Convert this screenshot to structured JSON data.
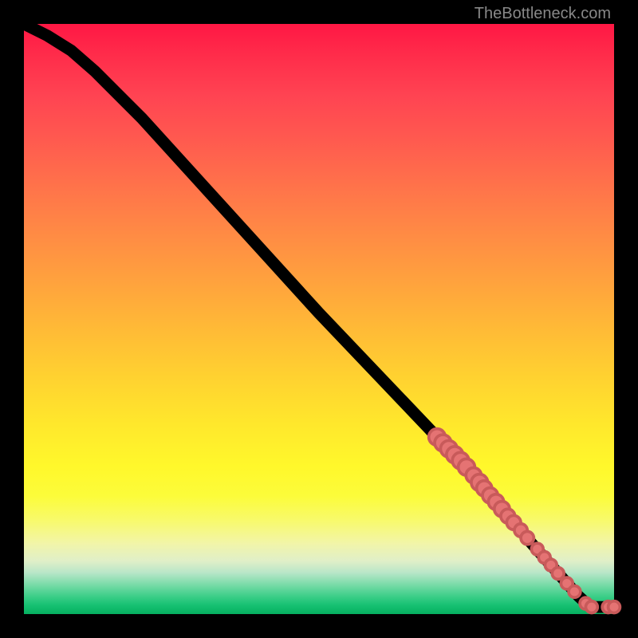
{
  "attribution": "TheBottleneck.com",
  "chart_data": {
    "type": "line",
    "title": "",
    "xlabel": "",
    "ylabel": "",
    "xlim": [
      0,
      100
    ],
    "ylim": [
      0,
      100
    ],
    "curve": [
      {
        "x": 0,
        "y": 100
      },
      {
        "x": 4,
        "y": 98
      },
      {
        "x": 8,
        "y": 95.5
      },
      {
        "x": 12,
        "y": 92
      },
      {
        "x": 20,
        "y": 84
      },
      {
        "x": 30,
        "y": 73
      },
      {
        "x": 40,
        "y": 62
      },
      {
        "x": 50,
        "y": 51
      },
      {
        "x": 60,
        "y": 40.5
      },
      {
        "x": 70,
        "y": 30
      },
      {
        "x": 80,
        "y": 19
      },
      {
        "x": 86,
        "y": 12
      },
      {
        "x": 90,
        "y": 7.5
      },
      {
        "x": 94,
        "y": 3
      },
      {
        "x": 96,
        "y": 1.2
      },
      {
        "x": 98,
        "y": 1.2
      },
      {
        "x": 100,
        "y": 1.2
      }
    ],
    "markers": [
      {
        "x": 70,
        "y": 30,
        "r": 1.4
      },
      {
        "x": 71,
        "y": 29,
        "r": 1.4
      },
      {
        "x": 72,
        "y": 28,
        "r": 1.4
      },
      {
        "x": 73,
        "y": 27,
        "r": 1.4
      },
      {
        "x": 74,
        "y": 26,
        "r": 1.4
      },
      {
        "x": 75,
        "y": 24.9,
        "r": 1.4
      },
      {
        "x": 76.2,
        "y": 23.5,
        "r": 1.3
      },
      {
        "x": 77.2,
        "y": 22.3,
        "r": 1.4
      },
      {
        "x": 78,
        "y": 21.3,
        "r": 1.3
      },
      {
        "x": 79,
        "y": 20.1,
        "r": 1.3
      },
      {
        "x": 80,
        "y": 19,
        "r": 1.3
      },
      {
        "x": 81,
        "y": 17.8,
        "r": 1.3
      },
      {
        "x": 82,
        "y": 16.6,
        "r": 1.2
      },
      {
        "x": 83,
        "y": 15.5,
        "r": 1.2
      },
      {
        "x": 84.2,
        "y": 14.2,
        "r": 1.1
      },
      {
        "x": 85.3,
        "y": 12.9,
        "r": 1.1
      },
      {
        "x": 87,
        "y": 11,
        "r": 1.0
      },
      {
        "x": 88.2,
        "y": 9.6,
        "r": 1.0
      },
      {
        "x": 89.3,
        "y": 8.3,
        "r": 1.0
      },
      {
        "x": 90.5,
        "y": 6.9,
        "r": 1.0
      },
      {
        "x": 92,
        "y": 5.2,
        "r": 1.0
      },
      {
        "x": 93.3,
        "y": 3.8,
        "r": 1.0
      },
      {
        "x": 95.2,
        "y": 1.8,
        "r": 1.0
      },
      {
        "x": 96.2,
        "y": 1.2,
        "r": 1.0
      },
      {
        "x": 99,
        "y": 1.2,
        "r": 1.0
      },
      {
        "x": 100,
        "y": 1.2,
        "r": 1.0
      }
    ]
  }
}
